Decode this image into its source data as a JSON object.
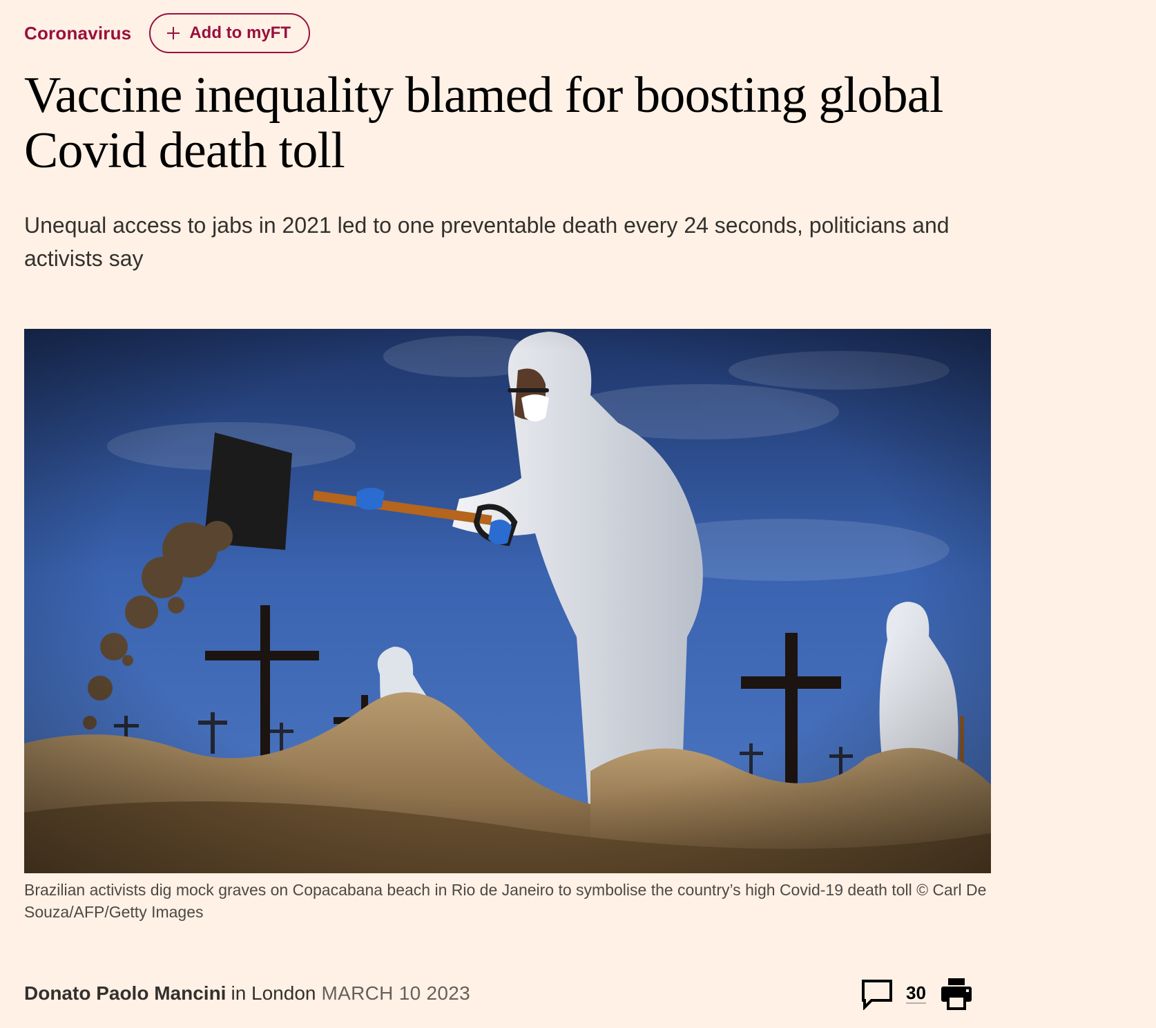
{
  "topic": {
    "label": "Coronavirus",
    "myft_button_label": "Add to myFT",
    "accent_color": "#990f3d"
  },
  "article": {
    "headline": "Vaccine inequality blamed for boosting global Covid death toll",
    "standfirst": "Unequal access to jabs in 2021 led to one preventable death every 24 seconds, politicians and activists say",
    "image_caption": "Brazilian activists dig mock graves on Copacabana beach in Rio de Janeiro to symbolise the country’s high Covid-19 death toll © Carl De Souza/AFP/Getty Images"
  },
  "byline": {
    "author": "Donato Paolo Mancini",
    "location": "in London",
    "date": "MARCH 10 2023"
  },
  "tools": {
    "comment_icon": "speech-bubble-icon",
    "comment_count": "30",
    "print_icon": "printer-icon"
  },
  "colors": {
    "page_background": "#fff1e5",
    "headline": "#000000",
    "body_text": "#33302e"
  }
}
